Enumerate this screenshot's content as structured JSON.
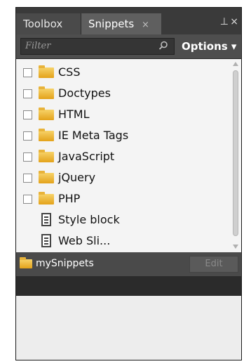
{
  "tabs": [
    {
      "label": "Toolbox"
    },
    {
      "label": "Snippets",
      "close": "×"
    }
  ],
  "window_controls": {
    "pin": "⊥",
    "close": "×"
  },
  "search": {
    "placeholder": "Filter"
  },
  "options_label": "Options ▾",
  "items": [
    {
      "label": "CSS",
      "type": "folder"
    },
    {
      "label": "Doctypes",
      "type": "folder"
    },
    {
      "label": "HTML",
      "type": "folder"
    },
    {
      "label": "IE Meta Tags",
      "type": "folder"
    },
    {
      "label": "JavaScript",
      "type": "folder"
    },
    {
      "label": "jQuery",
      "type": "folder"
    },
    {
      "label": "PHP",
      "type": "folder"
    },
    {
      "label": "Style block",
      "type": "file"
    },
    {
      "label": "Web Sli...",
      "type": "file"
    }
  ],
  "my_snippets": {
    "label": "mySnippets",
    "edit_label": "Edit"
  },
  "colors": {
    "panel_dark": "#323232",
    "list_bg": "#f4f4f4",
    "folder": "#f2c04a"
  }
}
